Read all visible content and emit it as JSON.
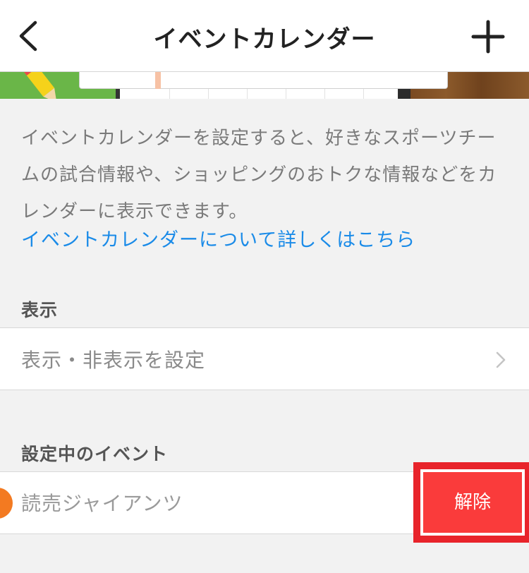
{
  "header": {
    "title": "イベントカレンダー",
    "back_icon": "chevron-left-icon",
    "add_icon": "plus-icon"
  },
  "intro": {
    "description": "イベントカレンダーを設定すると、好きなスポーツチームの試合情報や、ショッピングのおトクな情報などをカレンダーに表示できます。",
    "link_label": "イベントカレンダーについて詳しくはこちら"
  },
  "display_section": {
    "header": "表示",
    "row_label": "表示・非表示を設定",
    "row_icon": "chevron-right-icon"
  },
  "events_section": {
    "header": "設定中のイベント",
    "items": [
      {
        "label": "読売ジャイアンツ",
        "action_label": "解除"
      }
    ]
  },
  "colors": {
    "accent_link": "#1a8be8",
    "destructive": "#fa3b3b",
    "highlight_frame": "#e8242b",
    "team_badge": "#f37a21"
  }
}
